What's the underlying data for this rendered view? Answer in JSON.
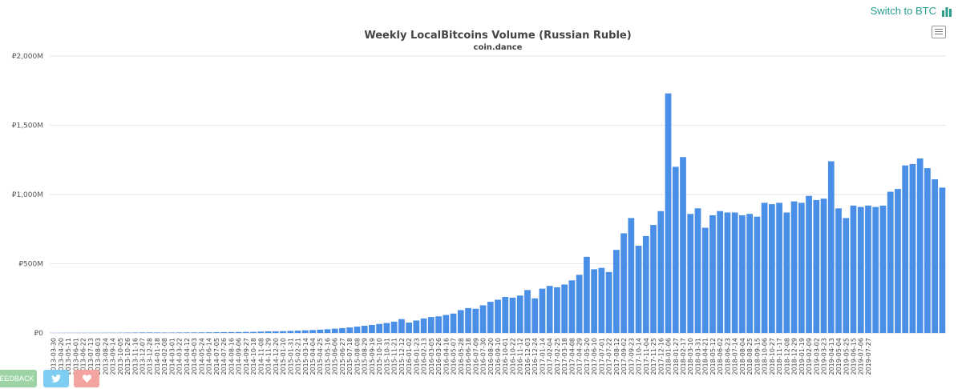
{
  "toolbar": {
    "switch_label": "Switch to BTC",
    "switch_icon": "bar-chart-icon",
    "menu_icon": "hamburger-menu-icon"
  },
  "buttons": {
    "feedback_label": "EEDBACK",
    "twitter_icon": "twitter-bird-icon",
    "heart_icon": "heart-icon"
  },
  "colors": {
    "bar": "#4a8fe7",
    "accent": "#2a9d8f"
  },
  "chart_data": {
    "type": "bar",
    "title": "Weekly LocalBitcoins Volume (Russian Ruble)",
    "subtitle": "coin.dance",
    "ylim": [
      0,
      2000
    ],
    "yticks": [
      "₽0",
      "₽500M",
      "₽1,000M",
      "₽1,500M",
      "₽2,000M"
    ],
    "ytick_values": [
      0,
      500,
      1000,
      1500,
      2000
    ],
    "unit": "M RUB",
    "grid": true,
    "categories": [
      "2013-03-30",
      "2013-04-20",
      "2013-05-11",
      "2013-06-01",
      "2013-06-22",
      "2013-07-13",
      "2013-08-03",
      "2013-08-24",
      "2013-09-14",
      "2013-10-05",
      "2013-10-26",
      "2013-11-16",
      "2013-12-07",
      "2013-12-28",
      "2014-01-18",
      "2014-02-08",
      "2014-03-01",
      "2014-03-22",
      "2014-04-12",
      "2014-05-03",
      "2014-05-24",
      "2014-06-14",
      "2014-07-05",
      "2014-07-26",
      "2014-08-16",
      "2014-09-06",
      "2014-09-27",
      "2014-10-18",
      "2014-11-08",
      "2014-11-29",
      "2014-12-20",
      "2015-01-10",
      "2015-01-31",
      "2015-02-21",
      "2015-03-14",
      "2015-04-04",
      "2015-04-25",
      "2015-05-16",
      "2015-06-06",
      "2015-06-27",
      "2015-07-18",
      "2015-08-08",
      "2015-08-29",
      "2015-09-19",
      "2015-10-10",
      "2015-10-31",
      "2015-11-21",
      "2015-12-12",
      "2016-01-02",
      "2016-01-23",
      "2016-02-13",
      "2016-03-05",
      "2016-03-26",
      "2016-04-16",
      "2016-05-07",
      "2016-05-28",
      "2016-06-18",
      "2016-07-09",
      "2016-07-30",
      "2016-08-20",
      "2016-09-10",
      "2016-10-01",
      "2016-10-22",
      "2016-11-12",
      "2016-12-03",
      "2016-12-24",
      "2017-01-14",
      "2017-02-04",
      "2017-02-25",
      "2017-03-18",
      "2017-04-08",
      "2017-04-29",
      "2017-05-20",
      "2017-06-10",
      "2017-07-01",
      "2017-07-22",
      "2017-08-12",
      "2017-09-02",
      "2017-09-23",
      "2017-10-14",
      "2017-11-04",
      "2017-11-25",
      "2017-12-16",
      "2018-01-06",
      "2018-01-27",
      "2018-02-17",
      "2018-03-10",
      "2018-03-31",
      "2018-04-21",
      "2018-05-12",
      "2018-06-02",
      "2018-06-23",
      "2018-07-14",
      "2018-08-04",
      "2018-08-25",
      "2018-09-15",
      "2018-10-06",
      "2018-10-27",
      "2018-11-17",
      "2018-12-08",
      "2018-12-29",
      "2019-01-19",
      "2019-02-09",
      "2019-03-02",
      "2019-03-23",
      "2019-04-13",
      "2019-05-04",
      "2019-05-25",
      "2019-06-15",
      "2019-07-06",
      "2019-07-27"
    ],
    "values": [
      0.5,
      0.6,
      0.8,
      1,
      1,
      1.2,
      1.4,
      1.5,
      1.8,
      2,
      2.5,
      3,
      3.5,
      3.8,
      3.5,
      3,
      3,
      3.5,
      4,
      4,
      4.5,
      5,
      5.5,
      6,
      6.5,
      7,
      7.5,
      8,
      10,
      12,
      12,
      13,
      15,
      17,
      19,
      21,
      24,
      27,
      31,
      35,
      40,
      46,
      52,
      58,
      65,
      72,
      82,
      100,
      75,
      90,
      105,
      115,
      120,
      130,
      140,
      165,
      180,
      175,
      200,
      225,
      240,
      260,
      255,
      270,
      310,
      250,
      320,
      340,
      330,
      350,
      380,
      420,
      550,
      460,
      470,
      440,
      600,
      720,
      830,
      630,
      700,
      780,
      880,
      1730,
      1200,
      1270,
      860,
      900,
      760,
      850,
      880,
      870,
      870,
      850,
      860,
      840,
      940,
      930,
      940,
      870,
      950,
      940,
      990,
      960,
      970,
      1240,
      900,
      830,
      920,
      910,
      920,
      910,
      920,
      1020,
      1040,
      1210,
      1220,
      1260,
      1190,
      1110,
      1050
    ]
  }
}
